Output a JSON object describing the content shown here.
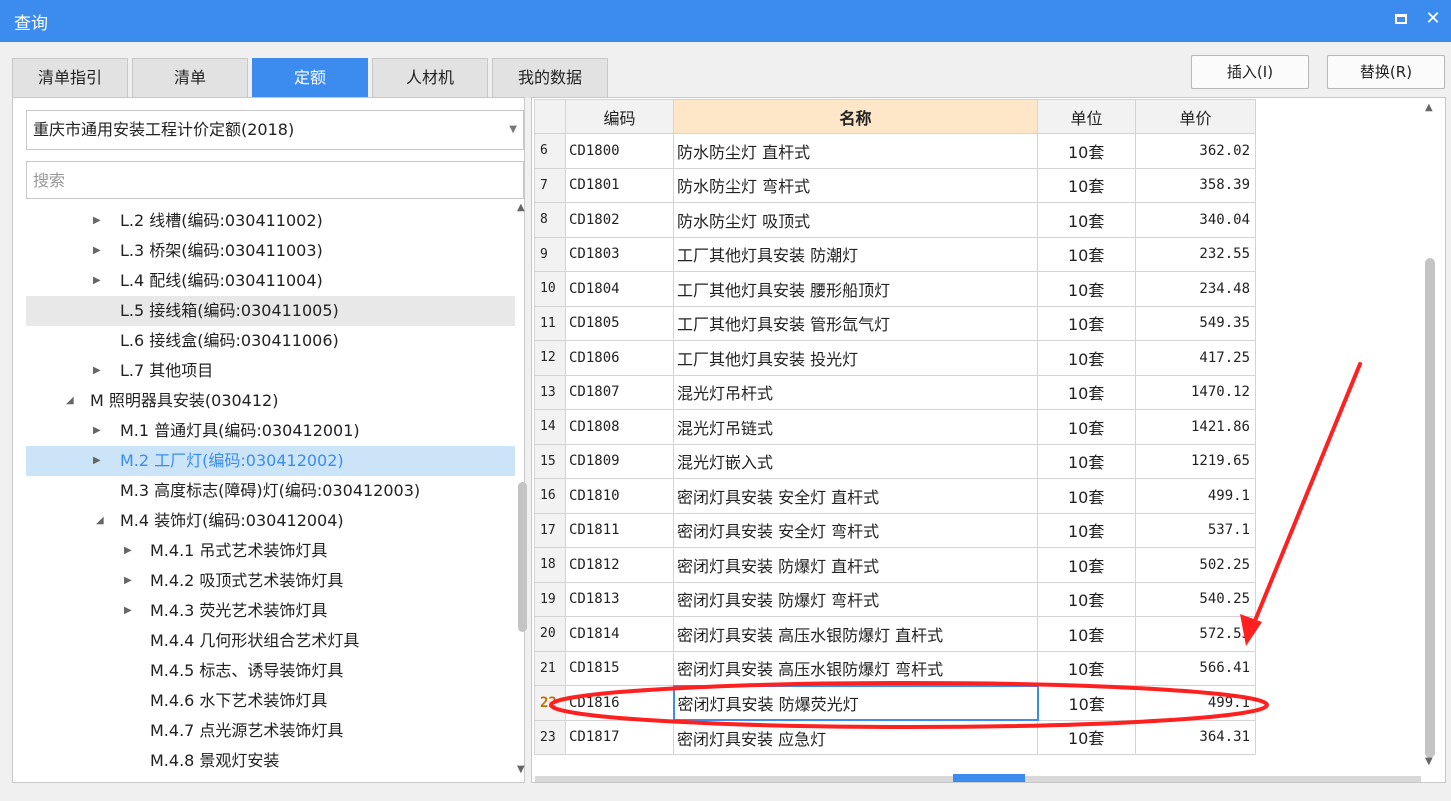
{
  "window": {
    "title": "查询",
    "maximize_label": "□",
    "close_label": "✕"
  },
  "tabs": [
    "清单指引",
    "清单",
    "定额",
    "人材机",
    "我的数据"
  ],
  "actions": {
    "insert": "插入(I)",
    "replace": "替换(R)"
  },
  "quota_library": "重庆市通用安装工程计价定额(2018)",
  "search": {
    "placeholder": "搜索",
    "value": ""
  },
  "tree": [
    {
      "label": "L.2 线槽(编码:030411002)",
      "expander": "▶"
    },
    {
      "label": "L.3 桥架(编码:030411003)",
      "expander": "▶"
    },
    {
      "label": "L.4 配线(编码:030411004)",
      "expander": "▶"
    },
    {
      "label": "L.5 接线箱(编码:030411005)",
      "expander": ""
    },
    {
      "label": "L.6 接线盒(编码:030411006)",
      "expander": ""
    },
    {
      "label": "L.7 其他项目",
      "expander": "▶"
    },
    {
      "label": "M 照明器具安装(030412)",
      "expander": "◢"
    },
    {
      "label": "M.1 普通灯具(编码:030412001)",
      "expander": "▶"
    },
    {
      "label": "M.2 工厂灯(编码:030412002)",
      "expander": "▶"
    },
    {
      "label": "M.3 高度标志(障碍)灯(编码:030412003)",
      "expander": ""
    },
    {
      "label": "M.4 装饰灯(编码:030412004)",
      "expander": "◢"
    },
    {
      "label": "M.4.1 吊式艺术装饰灯具",
      "expander": "▶"
    },
    {
      "label": "M.4.2 吸顶式艺术装饰灯具",
      "expander": "▶"
    },
    {
      "label": "M.4.3 荧光艺术装饰灯具",
      "expander": "▶"
    },
    {
      "label": "M.4.4 几何形状组合艺术灯具",
      "expander": ""
    },
    {
      "label": "M.4.5 标志、诱导装饰灯具",
      "expander": ""
    },
    {
      "label": "M.4.6 水下艺术装饰灯具",
      "expander": ""
    },
    {
      "label": "M.4.7 点光源艺术装饰灯具",
      "expander": ""
    },
    {
      "label": "M.4.8 景观灯安装",
      "expander": ""
    }
  ],
  "table": {
    "headers": {
      "code": "编码",
      "name": "名称",
      "unit": "单位",
      "price": "单价"
    },
    "rows": [
      {
        "num": "6",
        "code": "CD1800",
        "name": "防水防尘灯 直杆式",
        "unit": "10套",
        "price": "362.02"
      },
      {
        "num": "7",
        "code": "CD1801",
        "name": "防水防尘灯 弯杆式",
        "unit": "10套",
        "price": "358.39"
      },
      {
        "num": "8",
        "code": "CD1802",
        "name": "防水防尘灯 吸顶式",
        "unit": "10套",
        "price": "340.04"
      },
      {
        "num": "9",
        "code": "CD1803",
        "name": "工厂其他灯具安装 防潮灯",
        "unit": "10套",
        "price": "232.55"
      },
      {
        "num": "10",
        "code": "CD1804",
        "name": "工厂其他灯具安装 腰形船顶灯",
        "unit": "10套",
        "price": "234.48"
      },
      {
        "num": "11",
        "code": "CD1805",
        "name": "工厂其他灯具安装 管形氙气灯",
        "unit": "10套",
        "price": "549.35"
      },
      {
        "num": "12",
        "code": "CD1806",
        "name": "工厂其他灯具安装 投光灯",
        "unit": "10套",
        "price": "417.25"
      },
      {
        "num": "13",
        "code": "CD1807",
        "name": "混光灯吊杆式",
        "unit": "10套",
        "price": "1470.12"
      },
      {
        "num": "14",
        "code": "CD1808",
        "name": "混光灯吊链式",
        "unit": "10套",
        "price": "1421.86"
      },
      {
        "num": "15",
        "code": "CD1809",
        "name": "混光灯嵌入式",
        "unit": "10套",
        "price": "1219.65"
      },
      {
        "num": "16",
        "code": "CD1810",
        "name": "密闭灯具安装 安全灯 直杆式",
        "unit": "10套",
        "price": "499.1"
      },
      {
        "num": "17",
        "code": "CD1811",
        "name": "密闭灯具安装 安全灯 弯杆式",
        "unit": "10套",
        "price": "537.1"
      },
      {
        "num": "18",
        "code": "CD1812",
        "name": "密闭灯具安装 防爆灯 直杆式",
        "unit": "10套",
        "price": "502.25"
      },
      {
        "num": "19",
        "code": "CD1813",
        "name": "密闭灯具安装 防爆灯 弯杆式",
        "unit": "10套",
        "price": "540.25"
      },
      {
        "num": "20",
        "code": "CD1814",
        "name": "密闭灯具安装 高压水银防爆灯 直杆式",
        "unit": "10套",
        "price": "572.53"
      },
      {
        "num": "21",
        "code": "CD1815",
        "name": "密闭灯具安装 高压水银防爆灯 弯杆式",
        "unit": "10套",
        "price": "566.41"
      },
      {
        "num": "22",
        "code": "CD1816",
        "name": "密闭灯具安装 防爆荧光灯",
        "unit": "10套",
        "price": "499.1"
      },
      {
        "num": "23",
        "code": "CD1817",
        "name": "密闭灯具安装 应急灯",
        "unit": "10套",
        "price": "364.31"
      }
    ]
  },
  "colors": {
    "accent": "#3c8cf0",
    "annotation": "#ff2020",
    "header_highlight": "#fde7c8"
  }
}
